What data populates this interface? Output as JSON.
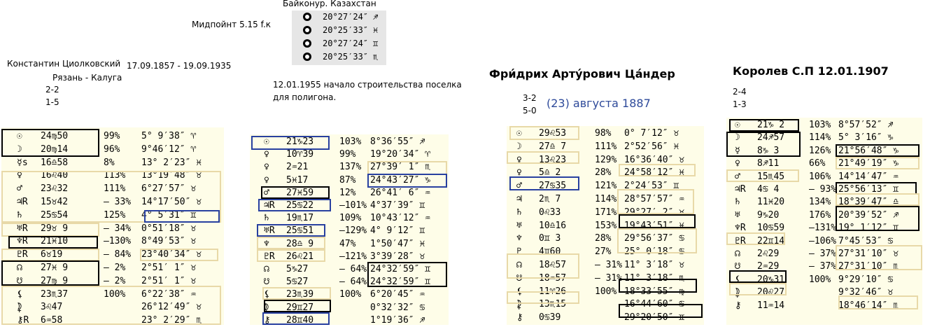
{
  "header": {
    "baikonur": "Байконур. Казахстан",
    "midpoint_label": "Мидпойнт 5.15 f.к",
    "midpoints": [
      {
        "icon": "sun-circle-icon",
        "value": "20°27′24″",
        "sign": "♐"
      },
      {
        "icon": "sun-circle-icon",
        "value": "20°25′33″",
        "sign": "♓"
      },
      {
        "icon": "sun-circle-icon",
        "value": "20°27′24″",
        "sign": "♊"
      },
      {
        "icon": "sun-circle-icon",
        "value": "20°25′33″",
        "sign": "♏"
      }
    ]
  },
  "tsiolkovsky": {
    "name": "Константин Циолковский",
    "dates": "17.09.1857 - 19.09.1935",
    "places": "Рязань - Калуга",
    "n1": "2-2",
    "n2": "1-5",
    "rows": [
      {
        "g": "☉",
        "p": "24♍50",
        "pct": "99%",
        "asp": "5° 9′38″ ♈"
      },
      {
        "g": "☽",
        "p": "20♍14",
        "pct": "96%",
        "asp": "9°46′12″ ♈"
      },
      {
        "g": "☿s",
        "p": "16♎58",
        "pct": "8%",
        "asp": "13° 2′23″ ♓"
      },
      {
        "g": "♀",
        "p": "16♌40",
        "pct": "113%",
        "asp": "13°19′48″ ♉"
      },
      {
        "g": "♂",
        "p": "23♌32",
        "pct": "111%",
        "asp": "6°27′57″ ♉"
      },
      {
        "g": "♃R",
        "p": "15♉42",
        "pct": "– 33%",
        "asp": "14°17′50″ ♉"
      },
      {
        "g": "♄",
        "p": "25♋54",
        "pct": "125%",
        "asp": "4° 5′31″ ♊"
      },
      {
        "g": "♅R",
        "p": "29♉ 9",
        "pct": "– 34%",
        "asp": "0°51′18″ ♉"
      },
      {
        "g": "♆R",
        "p": "21♓10",
        "pct": "–130%",
        "asp": "8°49′53″ ♉"
      },
      {
        "g": "♇R",
        "p": "6♉19",
        "pct": "– 84%",
        "asp": "23°40′34″ ♉"
      },
      {
        "g": "☊",
        "p": "27♓ 9",
        "pct": "– 2%",
        "asp": "2°51′ 1″ ♉"
      },
      {
        "g": "☋",
        "p": "27♍ 9",
        "pct": "– 2%",
        "asp": "2°51′ 1″ ♉"
      },
      {
        "g": "⚸",
        "p": "23♏37",
        "pct": "100%",
        "asp": "6°22′38″ ♒"
      },
      {
        "g": "⯝",
        "p": "3♌47",
        "pct": "",
        "asp": "26°12′49″ ♉"
      },
      {
        "g": "⚷R",
        "p": "6♒58",
        "pct": "",
        "asp": "23° 2′29″ ♏"
      }
    ]
  },
  "poligon": {
    "text1": "12.01.1955 начало строительства поселка",
    "text2": "для полигона.",
    "rows": [
      {
        "g": "☉",
        "p": "21♑23",
        "pct": "103%",
        "asp": "8°36′55″ ♐"
      },
      {
        "g": "♀",
        "p": "10♈39",
        "pct": "99%",
        "asp": "19°20′34″ ♈"
      },
      {
        "g": "♀",
        "p": "2♒21",
        "pct": "137%",
        "asp": "27°39′ 1″ ♏"
      },
      {
        "g": "♀",
        "p": "5♓17",
        "pct": "87%",
        "asp": "24°43′27″ ♑"
      },
      {
        "g": "♂",
        "p": "27♓59",
        "pct": "12%",
        "asp": "26°41′ 6″ ♒"
      },
      {
        "g": "♃R",
        "p": "25♋22",
        "pct": "–101%",
        "asp": "4°37′39″ ♊"
      },
      {
        "g": "♄",
        "p": "19♏17",
        "pct": "109%",
        "asp": "10°43′12″ ♒"
      },
      {
        "g": "♅R",
        "p": "25♋51",
        "pct": "–129%",
        "asp": "4° 9′12″ ♊"
      },
      {
        "g": "♆",
        "p": "28♎ 9",
        "pct": "47%",
        "asp": "1°50′47″ ♓"
      },
      {
        "g": "♇R",
        "p": "26♌21",
        "pct": "–121%",
        "asp": "3°39′28″ ♉"
      },
      {
        "g": "☊",
        "p": "5♑27",
        "pct": "– 64%",
        "asp": "24°32′59″ ♊"
      },
      {
        "g": "☋",
        "p": "5♋27",
        "pct": "– 64%",
        "asp": "24°32′59″ ♊"
      },
      {
        "g": "⚸",
        "p": "23♏39",
        "pct": "100%",
        "asp": "6°20′45″ ♒"
      },
      {
        "g": "⯝",
        "p": "29♊27",
        "pct": "",
        "asp": "0°32′32″ ♋"
      },
      {
        "g": "⚷",
        "p": "28♊40",
        "pct": "",
        "asp": "1°19′36″ ♐"
      }
    ]
  },
  "tsander": {
    "name": "Фри́дрих Арту́рович Ца́ндер",
    "date": "(23) августа 1887",
    "n1": "3-2",
    "n2": "5-0",
    "rows": [
      {
        "g": "☉",
        "p": "29♌53",
        "pct": "98%",
        "asp": "0° 7′12″ ♉"
      },
      {
        "g": "☽",
        "p": "27♎ 7",
        "pct": "111%",
        "asp": "2°52′56″ ♓"
      },
      {
        "g": "♀",
        "p": "13♌23",
        "pct": "129%",
        "asp": "16°36′40″ ♉"
      },
      {
        "g": "♀",
        "p": "5♎ 2",
        "pct": "28%",
        "asp": "24°58′12″ ♓"
      },
      {
        "g": "♂",
        "p": "27♋35",
        "pct": "121%",
        "asp": "2°24′53″ ♊"
      },
      {
        "g": "♃",
        "p": "2♏ 7",
        "pct": "114%",
        "asp": "28°57′57″ ♒"
      },
      {
        "g": "♄",
        "p": "0♌33",
        "pct": "171%",
        "asp": "29°27′ 2″ ♉"
      },
      {
        "g": "♅",
        "p": "10♎16",
        "pct": "153%",
        "asp": "19°43′51″ ♓"
      },
      {
        "g": "♆",
        "p": "0♊ 3",
        "pct": "28%",
        "asp": "29°56′37″ ♋"
      },
      {
        "g": "♇",
        "p": "4♊60",
        "pct": "27%",
        "asp": "25° 0′18″ ♋"
      },
      {
        "g": "☊",
        "p": "18♌57",
        "pct": "– 31%",
        "asp": "11° 3′18″ ♉"
      },
      {
        "g": "☋",
        "p": "18♒57",
        "pct": "– 31%",
        "asp": "11° 3′18″ ♏"
      },
      {
        "g": "⚸",
        "p": "11♈26",
        "pct": "100%",
        "asp": "18°33′55″ ♍"
      },
      {
        "g": "⯝",
        "p": "13♏15",
        "pct": "",
        "asp": "16°44′60″ ♋"
      },
      {
        "g": "⚷",
        "p": "0♋39",
        "pct": "",
        "asp": "29°20′50″ ♊"
      }
    ]
  },
  "korolev": {
    "name": "Королев С.П 12.01.1907",
    "n1": "2-4",
    "n2": "1-3",
    "rows": [
      {
        "g": "☉",
        "p": "21♑ 2",
        "pct": "103%",
        "asp": "8°57′52″ ♐"
      },
      {
        "g": "☽",
        "p": "24♐57",
        "pct": "114%",
        "asp": "5° 3′16″ ♑"
      },
      {
        "g": "☿",
        "p": "8♑ 3",
        "pct": "126%",
        "asp": "21°56′48″ ♑"
      },
      {
        "g": "♀",
        "p": "8♐11",
        "pct": "66%",
        "asp": "21°49′19″ ♑"
      },
      {
        "g": "♂",
        "p": "15♏45",
        "pct": "106%",
        "asp": "14°14′47″ ♒"
      },
      {
        "g": "♃R",
        "p": "4♋ 4",
        "pct": "– 93%",
        "asp": "25°56′13″ ♊"
      },
      {
        "g": "♄",
        "p": "11♓20",
        "pct": "134%",
        "asp": "18°39′47″ ♎"
      },
      {
        "g": "♅",
        "p": "9♑20",
        "pct": "176%",
        "asp": "20°39′52″ ♐"
      },
      {
        "g": "♆R",
        "p": "10♋59",
        "pct": "–131%",
        "asp": "19° 1′12″ ♊"
      },
      {
        "g": "♇R",
        "p": "22♊14",
        "pct": "–106%",
        "asp": "7°45′53″ ♋"
      },
      {
        "g": "☊",
        "p": "2♌29",
        "pct": "– 37%",
        "asp": "27°31′10″ ♉"
      },
      {
        "g": "☋",
        "p": "2♒29",
        "pct": "– 37%",
        "asp": "27°31′10″ ♏"
      },
      {
        "g": "⚸",
        "p": "20♑31",
        "pct": "100%",
        "asp": "9°29′10″ ♋"
      },
      {
        "g": "⯝",
        "p": "20♌27",
        "pct": "",
        "asp": "9°32′46″ ♉"
      },
      {
        "g": "⚷",
        "p": "11♒14",
        "pct": "",
        "asp": "18°46′14″ ♏"
      }
    ]
  }
}
